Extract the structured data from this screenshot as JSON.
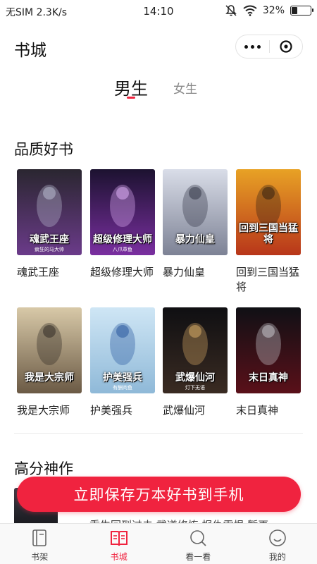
{
  "status_bar": {
    "carrier": "无SIM",
    "speed": "2.3K/s",
    "time": "14:10",
    "battery": "32%",
    "battery_level": 0.32
  },
  "header": {
    "title": "书城",
    "more_icon": "more-dots-icon",
    "close_icon": "close-circle-icon"
  },
  "gender_tabs": {
    "male": "男生",
    "female": "女生",
    "active": "male"
  },
  "sections": [
    {
      "title": "品质好书",
      "books": [
        {
          "title": "魂武王座",
          "cover_text": "魂武王座",
          "cover_author": "疯狂的马大帅"
        },
        {
          "title": "超级修理大师",
          "cover_text": "超级修理大师",
          "cover_author": "八爪章鱼"
        },
        {
          "title": "暴力仙皇",
          "cover_text": "暴力仙皇",
          "cover_author": ""
        },
        {
          "title": "回到三国当猛将",
          "cover_text": "回到三国当猛将",
          "cover_author": ""
        },
        {
          "title": "我是大宗师",
          "cover_text": "我是大宗师",
          "cover_author": ""
        },
        {
          "title": "护美强兵",
          "cover_text": "护美强兵",
          "cover_author": "有酬肉鱼"
        },
        {
          "title": "武爆仙河",
          "cover_text": "武爆仙河",
          "cover_author": "灯下无语"
        },
        {
          "title": "末日真神",
          "cover_text": "末日真神",
          "cover_author": ""
        }
      ]
    },
    {
      "title": "高分神作",
      "peek_text": "重生回到过去  武道修炼  报仇雪恨  暂再"
    }
  ],
  "cta": {
    "label": "立即保存万本好书到手机"
  },
  "tabbar": [
    {
      "label": "书架",
      "icon": "bookshelf-icon",
      "active": false
    },
    {
      "label": "书城",
      "icon": "book-store-icon",
      "active": true
    },
    {
      "label": "看一看",
      "icon": "search-browse-icon",
      "active": false
    },
    {
      "label": "我的",
      "icon": "profile-icon",
      "active": false
    }
  ],
  "colors": {
    "accent": "#f0233f",
    "text": "#222222",
    "muted": "#888888"
  }
}
